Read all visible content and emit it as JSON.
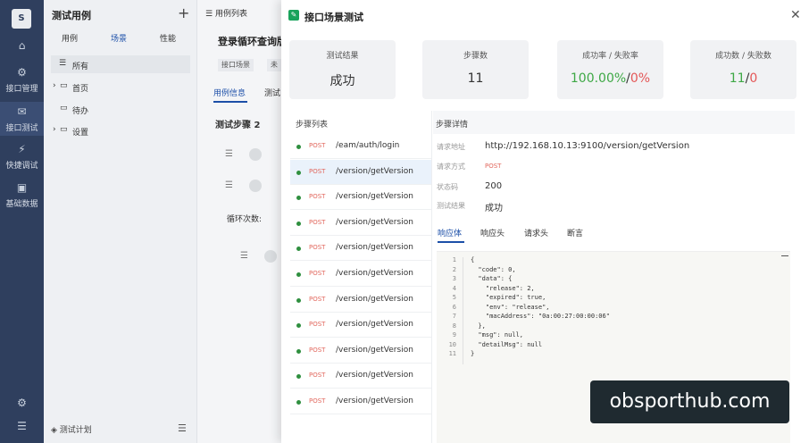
{
  "rail": {
    "logo": "S",
    "nav": [
      {
        "icon": "home-icon",
        "glyph": "⌂",
        "label": ""
      },
      {
        "icon": "api-icon",
        "glyph": "⚙",
        "label": "接口管理"
      },
      {
        "icon": "scene-icon",
        "glyph": "✉",
        "label": "接口测试"
      },
      {
        "icon": "quick-icon",
        "glyph": "⚡",
        "label": "快捷调试"
      },
      {
        "icon": "data-icon",
        "glyph": "▣",
        "label": "基础数据"
      }
    ],
    "bottom": [
      {
        "icon": "settings-icon",
        "glyph": "⚙"
      },
      {
        "icon": "menu-icon",
        "glyph": "☰"
      }
    ]
  },
  "cases": {
    "title": "测试用例",
    "tabs": [
      "用例",
      "场景",
      "性能"
    ],
    "tree": [
      {
        "label": "所有",
        "icon": "list-icon"
      },
      {
        "label": "首页",
        "icon": "folder-icon"
      },
      {
        "label": "待办",
        "icon": "folder-icon"
      },
      {
        "label": "设置",
        "icon": "folder-icon"
      }
    ],
    "plan": "测试计划"
  },
  "mid": {
    "header": "用例列表",
    "case_title": "登录循环查询版",
    "tags": [
      "接口场景",
      "未"
    ],
    "subtabs": [
      "用例信息",
      "测试"
    ],
    "step_title": "测试步骤 2",
    "loop_label": "循环次数:"
  },
  "modal": {
    "title": "接口场景测试",
    "cards": [
      {
        "label": "测试结果",
        "value": "成功"
      },
      {
        "label": "步骤数",
        "value": "11"
      },
      {
        "label": "成功率 / 失败率",
        "success": "100.00%",
        "sep": "/",
        "fail": "0%"
      },
      {
        "label": "成功数 / 失败数",
        "success": "11",
        "sep": "/",
        "fail": "0"
      }
    ],
    "step_list_title": "步骤列表",
    "steps": [
      {
        "method": "POST",
        "path": "/eam/auth/login"
      },
      {
        "method": "POST",
        "path": "/version/getVersion"
      },
      {
        "method": "POST",
        "path": "/version/getVersion"
      },
      {
        "method": "POST",
        "path": "/version/getVersion"
      },
      {
        "method": "POST",
        "path": "/version/getVersion"
      },
      {
        "method": "POST",
        "path": "/version/getVersion"
      },
      {
        "method": "POST",
        "path": "/version/getVersion"
      },
      {
        "method": "POST",
        "path": "/version/getVersion"
      },
      {
        "method": "POST",
        "path": "/version/getVersion"
      },
      {
        "method": "POST",
        "path": "/version/getVersion"
      },
      {
        "method": "POST",
        "path": "/version/getVersion"
      }
    ],
    "detail_title": "步骤详情",
    "detail": {
      "url_label": "请求地址",
      "url": "http://192.168.10.13:9100/version/getVersion",
      "method_label": "请求方式",
      "method": "POST",
      "status_label": "状态码",
      "status": "200",
      "result_label": "测试结果",
      "result": "成功"
    },
    "resp_tabs": [
      "响应体",
      "响应头",
      "请求头",
      "断言"
    ],
    "code_lines": [
      "{",
      "  \"code\": 0,",
      "  \"data\": {",
      "    \"release\": 2,",
      "    \"expired\": true,",
      "    \"env\": \"release\",",
      "    \"macAddress\": \"0a:00:27:00:00:06\"",
      "  },",
      "  \"msg\": null,",
      "  \"detailMsg\": null",
      "}"
    ]
  },
  "watermark": "obsporthub.com",
  "colors": {
    "success": "#3ea845",
    "fail": "#e45757",
    "accent": "#1c4fa8",
    "method": "#e2675d"
  }
}
